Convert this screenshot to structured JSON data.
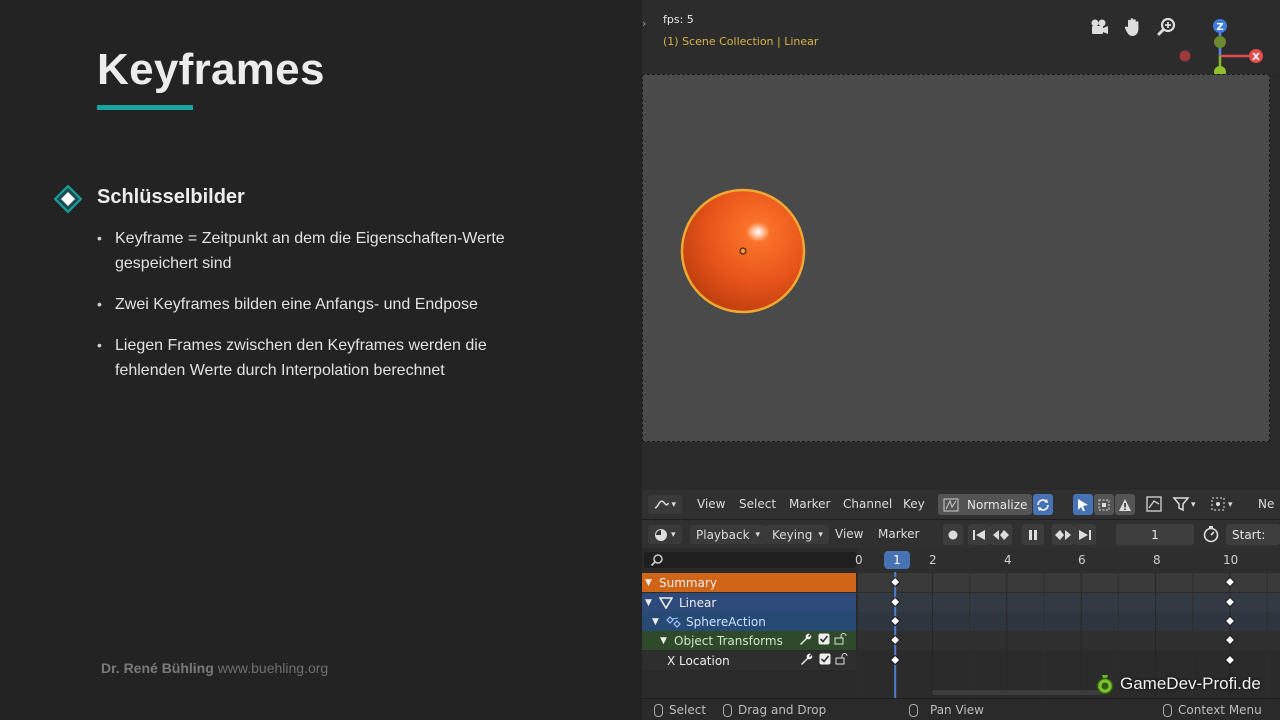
{
  "slide": {
    "title": "Keyframes",
    "section_heading": "Schlüsselbilder",
    "bullets": [
      "Keyframe = Zeitpunkt an dem die Eigenschaften-Werte gespeichert sind",
      "Zwei Keyframes bilden eine Anfangs- und Endpose",
      "Liegen Frames zwischen den Keyframes werden die fehlenden Werte durch Interpolation berechnet"
    ],
    "footer_name": "Dr. René Bühling",
    "footer_url": "www.buehling.org",
    "accent_color": "#16a3a2"
  },
  "viewport": {
    "fps_text": "fps: 5",
    "collection_text": "(1) Scene Collection | Linear",
    "nav_icons": [
      "camera-icon",
      "hand-pan-icon",
      "zoom-icon"
    ],
    "gizmo_labels": {
      "z": "Z",
      "x": "X"
    }
  },
  "dopesheet_header": {
    "menus": [
      "View",
      "Select",
      "Marker",
      "Channel",
      "Key"
    ],
    "normalize_label": "Normalize",
    "truncated_label": "Ne"
  },
  "timeline_header": {
    "playback_label": "Playback",
    "keying_label": "Keying",
    "view_label": "View",
    "marker_label": "Marker",
    "current_frame": "1",
    "start_label": "Start:"
  },
  "dopesheet": {
    "ruler_ticks": [
      "0",
      "2",
      "4",
      "6",
      "8",
      "10"
    ],
    "current_frame_label": "1",
    "channels": [
      {
        "label": "Summary",
        "color": "#d06417"
      },
      {
        "label": "Linear",
        "color": "#2d4a7a"
      },
      {
        "label": "SphereAction",
        "color": "#264a73"
      },
      {
        "label": "Object Transforms",
        "color": "#2e4a2a"
      },
      {
        "label": "X Location",
        "color": "#2e2e2e"
      }
    ],
    "keyframes": [
      1,
      10
    ]
  },
  "status_bar": {
    "select_label": "Select",
    "drag_label": "Drag and Drop",
    "pan_label": "Pan View",
    "context_label": "Context Menu"
  },
  "watermark": "GameDev-Profi.de"
}
